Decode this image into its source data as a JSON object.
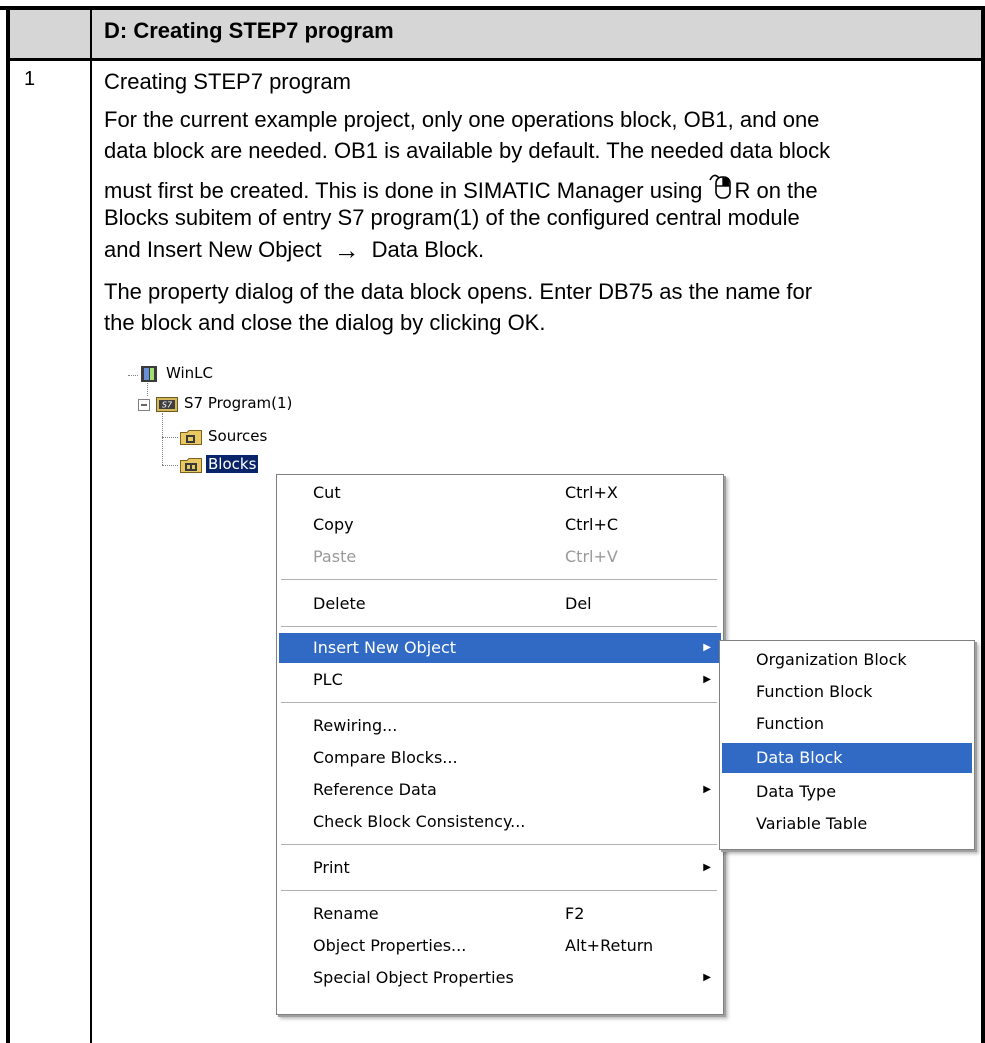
{
  "section": {
    "title": "D: Creating STEP7 program",
    "step_number": "1"
  },
  "content": {
    "heading": "Creating STEP7 program",
    "para2_line1": "For the current example project, only one operations block, OB1, and one",
    "para2_line2": "data block are needed. OB1 is available by default. The needed data block",
    "para3_part1": "must first be created. This is done in SIMATIC Manager using ",
    "para3_part2": "R on the",
    "para3_line2": "Blocks subitem of entry S7 program(1) of the configured central module",
    "para3_line3_a": "and Insert New Object",
    "para3_line3_b": "Data Block.",
    "para4_line1": "The property dialog of the data block opens. Enter DB75 as the name for",
    "para4_line2": "the block and close the dialog by clicking OK.",
    "arrow_glyph": "→"
  },
  "tree": {
    "root": "WinLC",
    "program": "S7 Program(1)",
    "program_badge": "S7",
    "sources": "Sources",
    "blocks": "Blocks",
    "expand_glyph": "−"
  },
  "context_menu": {
    "items": [
      {
        "label": "Cut",
        "shortcut": "Ctrl+X"
      },
      {
        "label": "Copy",
        "shortcut": "Ctrl+C"
      },
      {
        "label": "Paste",
        "shortcut": "Ctrl+V"
      },
      {
        "label": "Delete",
        "shortcut": "Del"
      },
      {
        "label": "Insert New Object",
        "shortcut": ""
      },
      {
        "label": "PLC",
        "shortcut": ""
      },
      {
        "label": "Rewiring...",
        "shortcut": ""
      },
      {
        "label": "Compare Blocks...",
        "shortcut": ""
      },
      {
        "label": "Reference Data",
        "shortcut": ""
      },
      {
        "label": "Check Block Consistency...",
        "shortcut": ""
      },
      {
        "label": "Print",
        "shortcut": ""
      },
      {
        "label": "Rename",
        "shortcut": "F2"
      },
      {
        "label": "Object Properties...",
        "shortcut": "Alt+Return"
      },
      {
        "label": "Special Object Properties",
        "shortcut": ""
      }
    ],
    "disabled": "Paste",
    "highlighted": "Insert New Object",
    "submenu_arrow": "▶"
  },
  "submenu": {
    "items": [
      "Organization Block",
      "Function Block",
      "Function",
      "Data Block",
      "Data Type",
      "Variable Table"
    ],
    "highlighted": "Data Block"
  },
  "colors": {
    "header_bg": "#d6d6d6",
    "menu_highlight": "#316ac5",
    "tree_selection": "#0a246a"
  }
}
